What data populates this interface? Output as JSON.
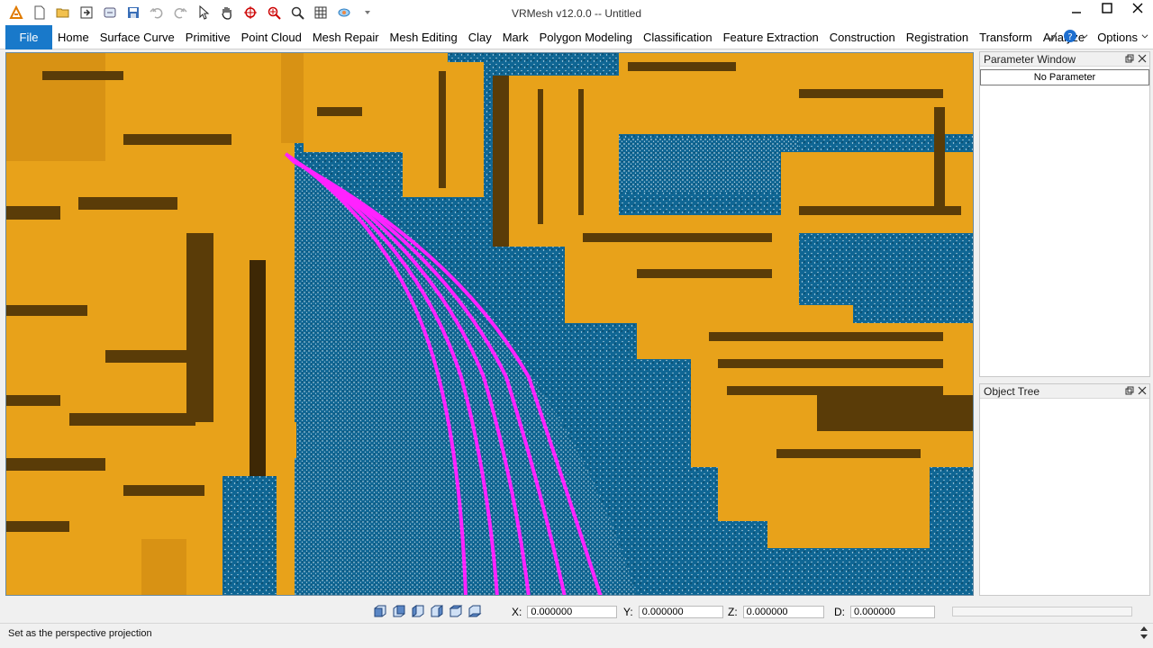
{
  "window": {
    "title": "VRMesh v12.0.0  -- Untitled"
  },
  "quick_access": [
    "logo-icon",
    "new-file-icon",
    "open-folder-icon",
    "import-icon",
    "export-icon",
    "save-icon",
    "undo-icon",
    "redo-icon",
    "select-arrow-icon",
    "pan-hand-icon",
    "rotate-icon",
    "zoom-window-icon",
    "zoom-icon",
    "zoom-extent-icon",
    "view-cube-icon",
    "customize-dropdown-icon"
  ],
  "menu": {
    "file_label": "File",
    "tabs": [
      "Home",
      "Surface Curve",
      "Primitive",
      "Point Cloud",
      "Mesh Repair",
      "Mesh Editing",
      "Clay",
      "Mark",
      "Polygon Modeling",
      "Classification",
      "Feature Extraction",
      "Construction",
      "Registration",
      "Transform",
      "Analyze"
    ],
    "options_label": "Options"
  },
  "panels": {
    "parameter": {
      "title": "Parameter Window",
      "button": "No Parameter"
    },
    "object_tree": {
      "title": "Object Tree"
    }
  },
  "coords": {
    "x_label": "X:",
    "x_value": "0.000000",
    "y_label": "Y:",
    "y_value": "0.000000",
    "z_label": "Z:",
    "z_value": "0.000000",
    "d_label": "D:",
    "d_value": "0.000000"
  },
  "view_buttons": [
    "front-view-icon",
    "back-view-icon",
    "left-view-icon",
    "right-view-icon",
    "top-view-icon",
    "bottom-view-icon"
  ],
  "status": {
    "message": "Set as the perspective projection"
  },
  "colors": {
    "accent": "#1979ca",
    "ground": "#0f6694",
    "building": "#e8a21a",
    "building_shadow": "#5a3c08",
    "curve": "#ff22ff"
  }
}
